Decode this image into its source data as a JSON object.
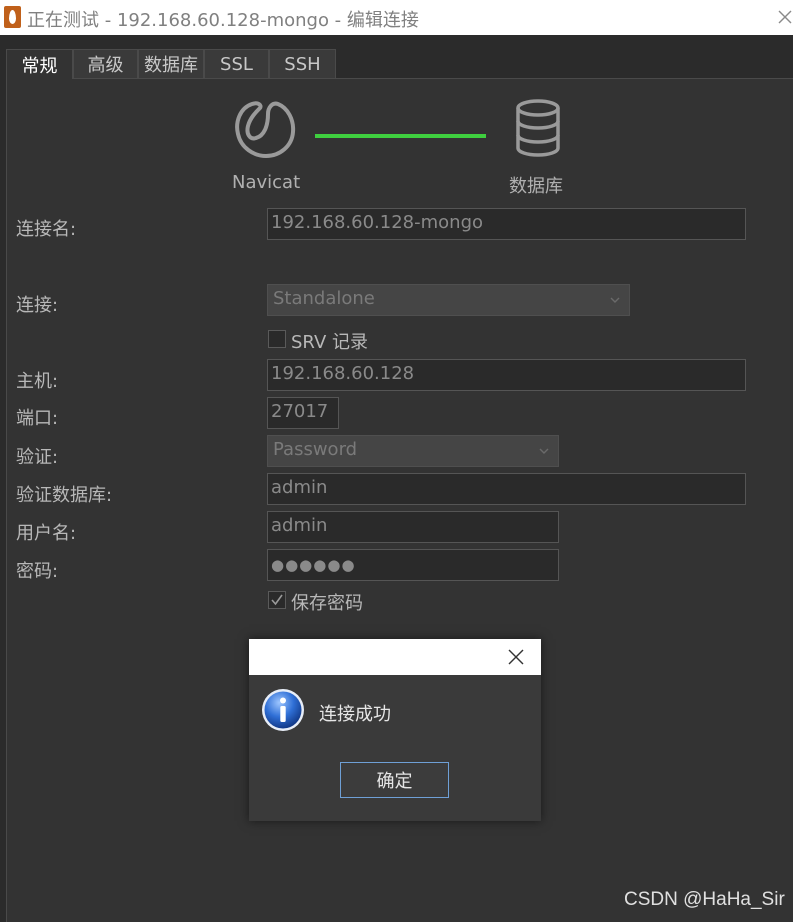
{
  "window": {
    "title": "正在测试 - 192.168.60.128-mongo - 编辑连接",
    "icons": {
      "app": "navicat-app-icon",
      "close": "close-icon"
    }
  },
  "tabs": [
    {
      "label": "常规",
      "active": true
    },
    {
      "label": "高级",
      "active": false
    },
    {
      "label": "数据库",
      "active": false
    },
    {
      "label": "SSL",
      "active": false
    },
    {
      "label": "SSH",
      "active": false
    }
  ],
  "diagram": {
    "left_label": "Navicat",
    "right_label": "数据库",
    "connection_color": "#3fcf3f",
    "icons": {
      "left": "navicat-logo-icon",
      "right": "database-icon"
    }
  },
  "form": {
    "connection_name": {
      "label": "连接名:",
      "value": "192.168.60.128-mongo"
    },
    "connection_type": {
      "label": "连接:",
      "value": "Standalone"
    },
    "srv_record": {
      "label": "SRV 记录",
      "checked": false
    },
    "host": {
      "label": "主机:",
      "value": "192.168.60.128"
    },
    "port": {
      "label": "端口:",
      "value": "27017"
    },
    "auth": {
      "label": "验证:",
      "value": "Password"
    },
    "auth_database": {
      "label": "验证数据库:",
      "value": "admin"
    },
    "username": {
      "label": "用户名:",
      "value": "admin"
    },
    "password": {
      "label": "密码:",
      "value": "●●●●●●"
    },
    "save_password": {
      "label": "保存密码",
      "checked": true
    }
  },
  "dialog": {
    "message": "连接成功",
    "ok_label": "确定",
    "icons": {
      "info": "info-icon",
      "close": "close-icon"
    }
  },
  "watermark": "CSDN @HaHa_Sir",
  "colors": {
    "background": "#2b2b2b",
    "panel": "#333333",
    "accent_green": "#3fcf3f",
    "button_border": "#6fa0d6"
  }
}
